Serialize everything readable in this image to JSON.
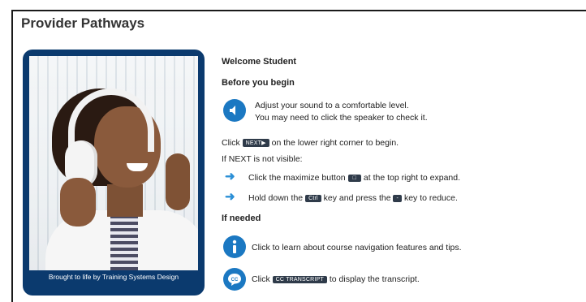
{
  "header": {
    "title": "Provider Pathways"
  },
  "photo": {
    "credit": "Brought to life by Training Systems Design"
  },
  "content": {
    "welcome": "Welcome Student",
    "before_heading": "Before you begin",
    "sound_line1": "Adjust your sound to a comfortable level.",
    "sound_line2": "You may need to click the speaker to check it.",
    "click_prefix": "Click",
    "next_badge": "NEXT▶",
    "click_suffix": "on the lower right corner to begin.",
    "if_next": "If NEXT is not visible:",
    "maximize_prefix": "Click the maximize button",
    "maximize_badge": "□",
    "maximize_suffix": "at the top right to expand.",
    "hold_prefix": "Hold down the",
    "ctrl_badge": "Ctrl",
    "hold_middle": "key and press the",
    "minus_badge": "-",
    "hold_suffix": "key to reduce.",
    "if_needed": "If needed",
    "info_text": "Click to learn about course navigation features and tips.",
    "transcript_prefix": "Click",
    "transcript_badge": "CC TRANSCRIPT",
    "transcript_suffix": "to display the transcript."
  },
  "icons": [
    "speaker-icon",
    "arrow-right-icon",
    "info-icon",
    "cc-icon"
  ],
  "colors": {
    "accent": "#1b78c2",
    "card": "#0b3a6e",
    "badge": "#2f3b4a"
  }
}
